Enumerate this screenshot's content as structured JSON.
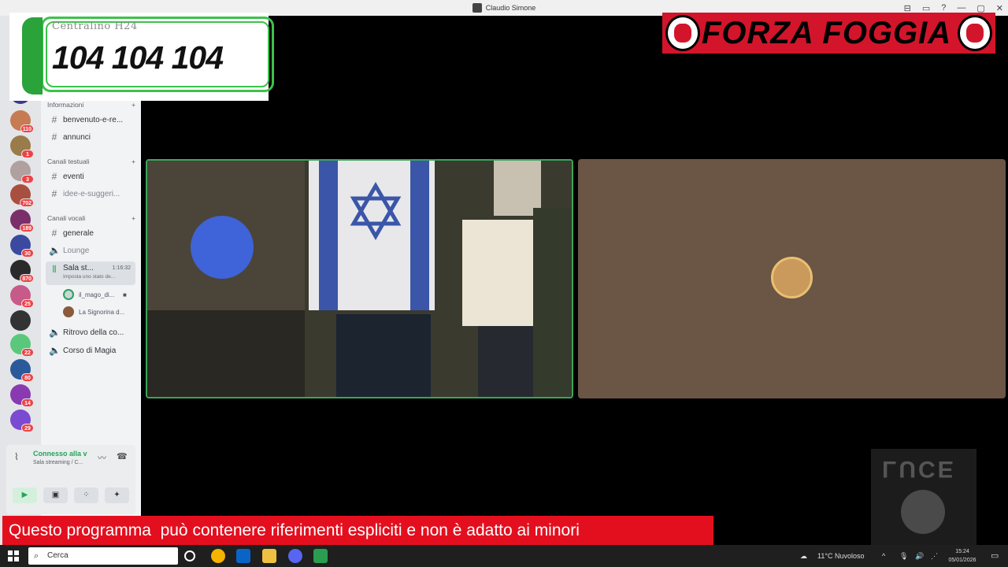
{
  "window": {
    "title": "Claudio Simone",
    "controls": [
      "⊟",
      "▭",
      "?",
      "—",
      "▢",
      "✕"
    ]
  },
  "servers": [
    {
      "badge": "",
      "color": "#d94a3a"
    },
    {
      "badge": "",
      "color": "#2f4fa8"
    },
    {
      "badge": "",
      "color": "#3a3a8c"
    },
    {
      "badge": "110",
      "color": "#c77b52"
    },
    {
      "badge": "1",
      "color": "#9a7b4a"
    },
    {
      "badge": "3",
      "color": "#b0a0a0"
    },
    {
      "badge": "702",
      "color": "#a94f3f"
    },
    {
      "badge": "189",
      "color": "#7a2f6a"
    },
    {
      "badge": "30",
      "color": "#3b4aa0"
    },
    {
      "badge": "870",
      "color": "#2a2a2a"
    },
    {
      "badge": "25",
      "color": "#c85a8a"
    },
    {
      "badge": "",
      "color": "#333333"
    },
    {
      "badge": "22",
      "color": "#5ac87a"
    },
    {
      "badge": "80",
      "color": "#2a5a9a"
    },
    {
      "badge": "14",
      "color": "#8a3ab0"
    },
    {
      "badge": "29",
      "color": "#7a4ad0"
    },
    {
      "badge": "",
      "color": "#e3e5e8"
    }
  ],
  "channels": {
    "cat_info": "Informazioni",
    "info_items": [
      "benvenuto-e-re...",
      "annunci"
    ],
    "cat_text": "Canali testuali",
    "text_items": [
      "eventi",
      "idee-e-suggeri..."
    ],
    "cat_voice": "Canali vocali",
    "voice_general": "generale",
    "voice_lounge": "Lounge",
    "stream": {
      "name": "Sala st...",
      "timer": "1:16:32",
      "status": "Imposta uno stato de..."
    },
    "users": [
      "il_mago_di...",
      "La Signorina d..."
    ],
    "voice_more": [
      "Ritrovo della co...",
      "Corso di Magia"
    ]
  },
  "voice_panel": {
    "connected": "Connesso alla v",
    "channel": "Sala streaming / C..."
  },
  "overlay_phone": {
    "label": "Centralino H24",
    "number": "104 104 104"
  },
  "overlay_banner": "FORZA FOGGIA",
  "overlay_logo": "LUCE",
  "warning": "Questo programma  può contenere riferimenti espliciti e non è adatto ai minori",
  "taskbar": {
    "search_placeholder": "Cerca",
    "weather": "11°C  Nuvoloso",
    "time": "15:24",
    "date": "05/01/2026"
  },
  "colors": {
    "discord_green": "#23a55a",
    "warning_red": "#e40f1e",
    "banner_red": "#d2152a",
    "phone_green": "#3cc24a"
  }
}
